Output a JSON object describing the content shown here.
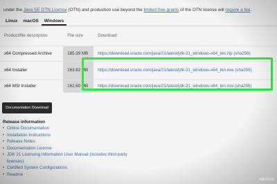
{
  "intro": {
    "prefix": "under the ",
    "license_link": "Java SE OTN License",
    "middle": " (OTN) and production use beyond the ",
    "grants_link": "limited free grants",
    "middle2": " of the OTN license will ",
    "fee_link": "require a fee",
    "suffix": "."
  },
  "tabs": [
    {
      "label": "Linux",
      "active": false
    },
    {
      "label": "macOS",
      "active": false
    },
    {
      "label": "Windows",
      "active": true
    }
  ],
  "table": {
    "headers": {
      "desc": "Product/file description",
      "size": "File size",
      "download": "Download"
    },
    "rows": [
      {
        "desc": "x64 Compressed Archive",
        "size": "185.39 MB",
        "url": "https://download.oracle.com/java/21/latest/jdk-21_windows-x64_bin.zip",
        "sha": "(sha256)"
      },
      {
        "desc": "x64 Installer",
        "size": "163.82 MB",
        "url": "https://download.oracle.com/java/21/latest/jdk-21_windows-x64_bin.exe",
        "sha": "(sha256)"
      },
      {
        "desc": "x64 MSI Installer",
        "size": "162.60 MB",
        "url": "https://download.oracle.com/java/21/latest/jdk-21_windows-x64_bin.msi",
        "sha": "(sha256)"
      }
    ]
  },
  "highlight_color": "#2ee64a",
  "doc_button": "Documentation Download",
  "release_info": {
    "title": "Release information",
    "items": [
      "Online Documentation",
      "Installation Instructions",
      "Release Notes",
      "Documentation License",
      "JDK 21 Licensing Information User Manual (includes third-party licenses)",
      "Certified System Configurations",
      "Readme"
    ]
  },
  "watermark": "wikiHow"
}
